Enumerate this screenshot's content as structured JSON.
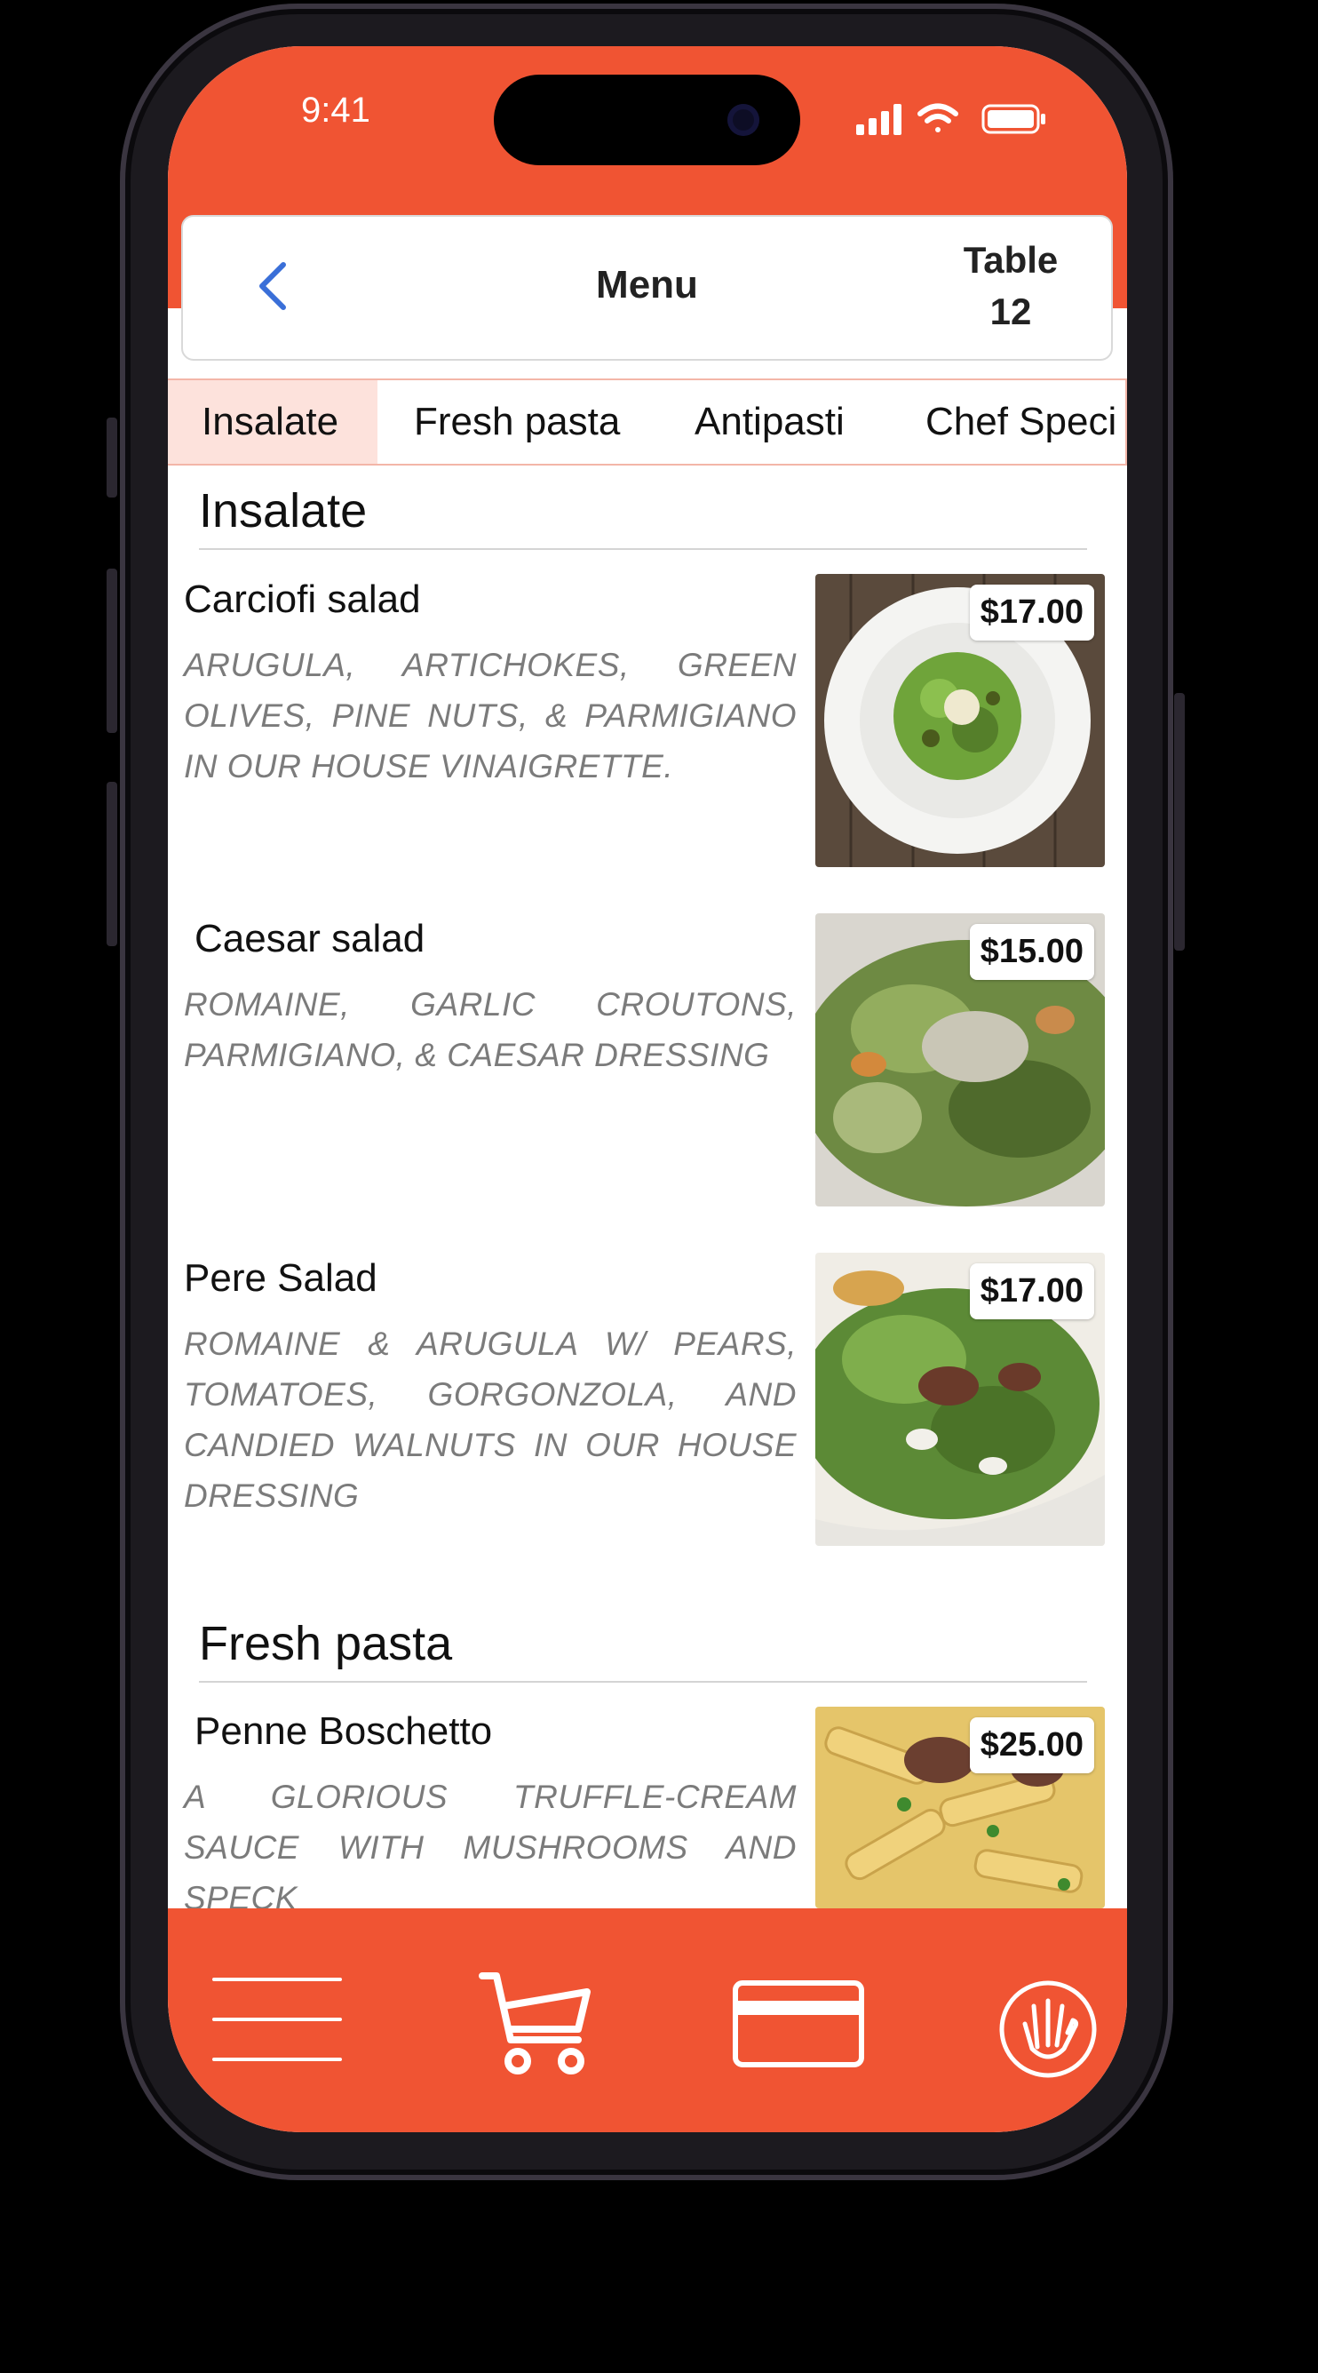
{
  "status_bar": {
    "time": "9:41"
  },
  "header": {
    "title": "Menu",
    "table_label": "Table\n12"
  },
  "tabs": [
    {
      "label": "Insalate",
      "active": true
    },
    {
      "label": "Fresh pasta",
      "active": false
    },
    {
      "label": "Antipasti",
      "active": false
    },
    {
      "label": "Chef Speci",
      "active": false
    }
  ],
  "sections": [
    {
      "title": "Insalate",
      "items": [
        {
          "name": "Carciofi salad",
          "description": "ARUGULA, ARTICHOKES, GREEN OLIVES, PINE NUTS, & PARMIGIANO IN OUR HOUSE VINAIGRETTE.",
          "price": "$17.00"
        },
        {
          "name": "Caesar salad",
          "description": "ROMAINE, GARLIC CROUTONS, PARMIGIANO, & CAESAR DRESSING",
          "price": "$15.00"
        },
        {
          "name": "Pere Salad",
          "description": "ROMAINE & ARUGULA W/ PEARS, TOMATOES, GORGONZOLA, AND CANDIED WALNUTS IN OUR HOUSE DRESSING",
          "price": "$17.00"
        }
      ]
    },
    {
      "title": "Fresh pasta",
      "items": [
        {
          "name": "Penne Boschetto",
          "description": "A GLORIOUS TRUFFLE-CREAM SAUCE WITH MUSHROOMS AND SPECK",
          "price": "$25.00"
        }
      ]
    }
  ],
  "bottom_nav": [
    "menu-lines-icon",
    "cart-icon",
    "card-icon",
    "hand-icon"
  ],
  "colors": {
    "brand": "#f05433",
    "tab_active_bg": "#fde2dc",
    "back_arrow": "#3a6fd8"
  }
}
